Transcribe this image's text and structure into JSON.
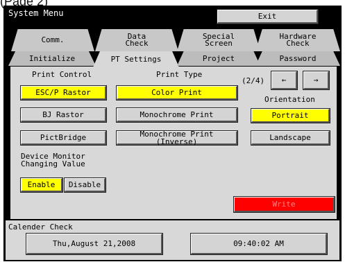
{
  "caption": "(Page 2)",
  "window": {
    "title": "System Menu",
    "exit_label": "Exit"
  },
  "tabs_row1": [
    {
      "label": "Comm."
    },
    {
      "label": "Data\nCheck"
    },
    {
      "label": "Special\nScreen"
    },
    {
      "label": "Hardware\nCheck"
    }
  ],
  "tabs_row2": [
    {
      "label": "Initialize"
    },
    {
      "label": "PT Settings",
      "active": true
    },
    {
      "label": "Project"
    },
    {
      "label": "Password"
    }
  ],
  "print_control": {
    "heading": "Print Control",
    "options": [
      "ESC/P Rastor",
      "BJ Rastor",
      "PictBridge"
    ],
    "selected": "ESC/P Rastor"
  },
  "print_type": {
    "heading": "Print Type",
    "options": [
      "Color Print",
      "Monochrome Print",
      "Monochrome Print (Inverse)"
    ],
    "selected": "Color Print"
  },
  "pager": {
    "page_indicator": "(2/4)",
    "prev_label": "←",
    "next_label": "→"
  },
  "orientation": {
    "heading": "Orientation",
    "options": [
      "Portrait",
      "Landscape"
    ],
    "selected": "Portrait"
  },
  "device_monitor": {
    "heading": "Device Monitor\nChanging Value",
    "enable_label": "Enable",
    "disable_label": "Disable",
    "selected": "Enable"
  },
  "write_label": "Write",
  "calendar": {
    "heading": "Calender Check",
    "date": "Thu,August 21,2008",
    "time": "09:40:02 AM"
  },
  "colors": {
    "selected": "#ffff00",
    "write": "#ff0000",
    "panel": "#d8d8d8",
    "frame": "#000000"
  }
}
